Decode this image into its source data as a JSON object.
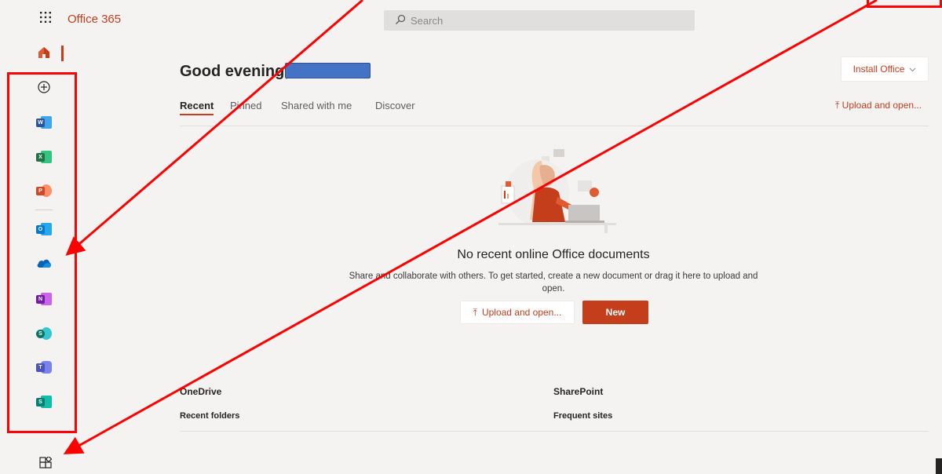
{
  "topbar": {
    "app_name": "Office 365",
    "search_placeholder": "Search"
  },
  "rail": {
    "items": [
      {
        "name": "home",
        "label": ""
      },
      {
        "name": "create",
        "label": ""
      },
      {
        "name": "word",
        "letter": "W",
        "color": "#2b579a"
      },
      {
        "name": "excel",
        "letter": "X",
        "color": "#217346"
      },
      {
        "name": "powerpoint",
        "letter": "P",
        "color": "#d24726"
      },
      {
        "name": "outlook",
        "letter": "O",
        "color": "#0078d4"
      },
      {
        "name": "onedrive",
        "letter": "",
        "color": "#0364b8"
      },
      {
        "name": "onenote",
        "letter": "N",
        "color": "#7719aa"
      },
      {
        "name": "sharepoint",
        "letter": "S",
        "color": "#077568"
      },
      {
        "name": "teams",
        "letter": "T",
        "color": "#4b53bc"
      },
      {
        "name": "sway",
        "letter": "S",
        "color": "#008272"
      }
    ]
  },
  "main": {
    "greeting": "Good evening,",
    "install_label": "Install Office",
    "tabs": [
      {
        "label": "Recent",
        "active": true
      },
      {
        "label": "Pinned",
        "active": false
      },
      {
        "label": "Shared with me",
        "active": false
      },
      {
        "label": "Discover",
        "active": false
      }
    ],
    "upload_label": "Upload and open...",
    "empty_title": "No recent online Office documents",
    "empty_desc": "Share and collaborate with others. To get started, create a new document or drag it here to upload and open.",
    "upload_button": "Upload and open...",
    "new_button": "New"
  },
  "sections": {
    "onedrive": {
      "title": "OneDrive",
      "sub": "Recent folders"
    },
    "sharepoint": {
      "title": "SharePoint",
      "sub": "Frequent sites"
    }
  },
  "colors": {
    "accent": "#c43e1c",
    "annotation": "#ff0000",
    "redaction": "#4472c4"
  }
}
